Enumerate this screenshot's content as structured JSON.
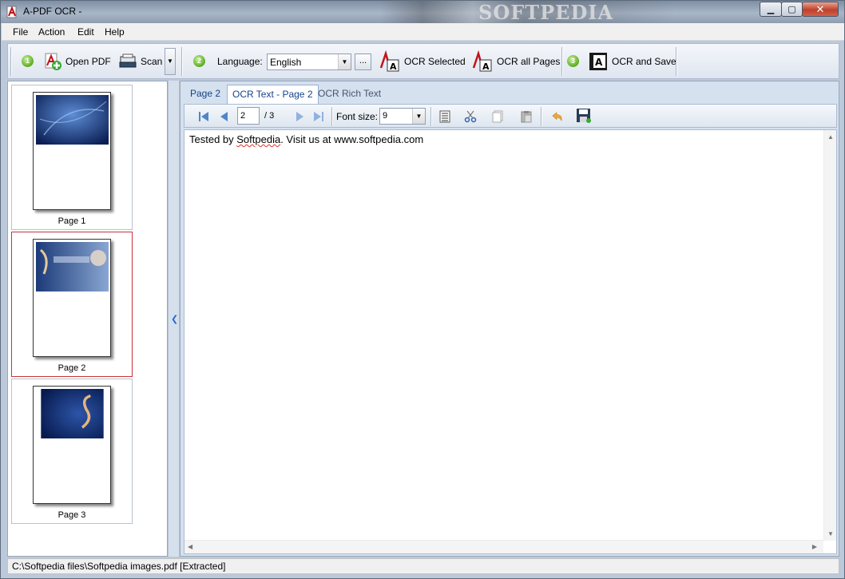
{
  "window": {
    "title": "A-PDF OCR -",
    "title_watermark": "SOFTPEDIA",
    "controls": {
      "minimize": "▁",
      "maximize": "▢",
      "close": "✕"
    }
  },
  "menu": [
    "File",
    "Action",
    "Edit",
    "Help"
  ],
  "toolbar": {
    "steps": [
      "1",
      "2",
      "3"
    ],
    "open_pdf": "Open PDF",
    "scan": "Scan",
    "language_label": "Language:",
    "language_value": "English",
    "language_more": "...",
    "ocr_selected": "OCR Selected",
    "ocr_all_pages": "OCR all Pages",
    "ocr_and_save": "OCR and Save"
  },
  "thumbnails": [
    {
      "caption": "Page 1",
      "selected": false
    },
    {
      "caption": "Page 2",
      "selected": true
    },
    {
      "caption": "Page 3",
      "selected": false
    }
  ],
  "tabs": [
    {
      "label": "Page 2",
      "active": false
    },
    {
      "label": "OCR Text - Page 2",
      "active": true
    },
    {
      "label": "OCR Rich Text",
      "active": false
    }
  ],
  "text_toolbar": {
    "page_current": "2",
    "page_total": "/ 3",
    "font_size_label": "Font size:",
    "font_size_value": "9"
  },
  "editor": {
    "text_before": "Tested by ",
    "misspelled": "Softpedia",
    "text_after": ". Visit us at www.softpedia.com"
  },
  "status": "C:\\Softpedia files\\Softpedia images.pdf [Extracted]",
  "colors": {
    "title_bg": "#a8b6c8",
    "selected_thumb_border": "#c8333b",
    "tab_text": "#15428b",
    "step_green": "#5aac1e"
  }
}
